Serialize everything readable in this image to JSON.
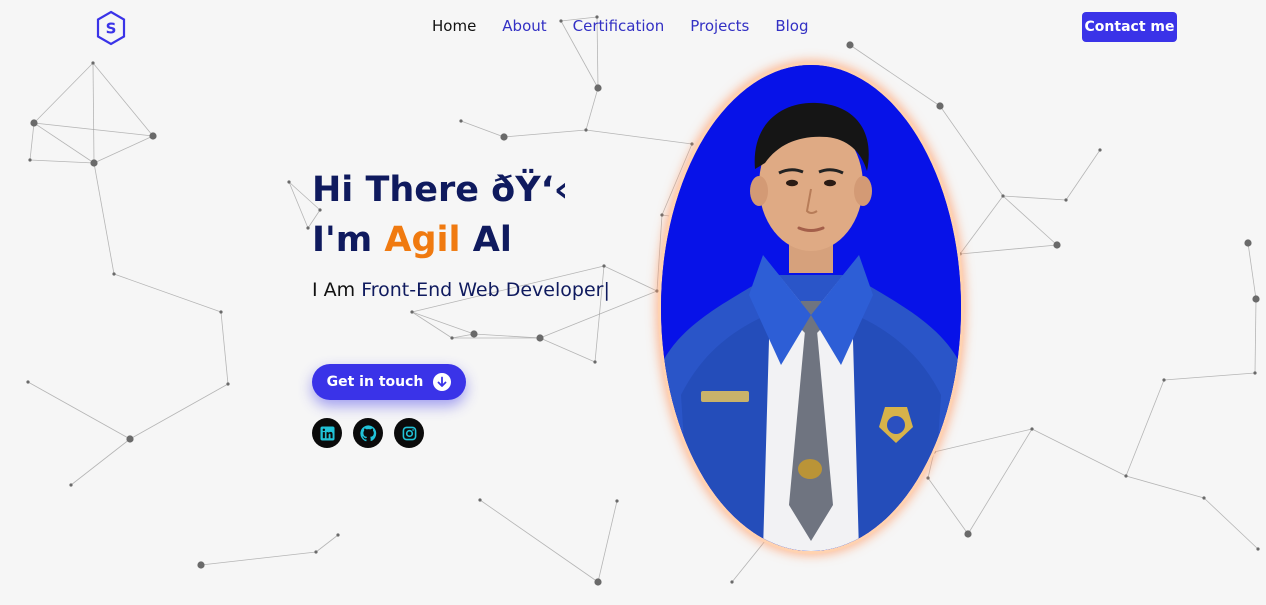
{
  "logo": {
    "letter": "S",
    "icon": "hexagon-logo-icon"
  },
  "nav": {
    "items": [
      {
        "label": "Home",
        "active": true
      },
      {
        "label": "About",
        "active": false
      },
      {
        "label": "Certification",
        "active": false
      },
      {
        "label": "Projects",
        "active": false
      },
      {
        "label": "Blog",
        "active": false
      }
    ],
    "contact_label": "Contact me"
  },
  "hero": {
    "greeting": "Hi There ðŸ‘‹",
    "name_prefix": "I'm ",
    "name_highlight": "Agil",
    "name_suffix": " Al",
    "subtitle_prefix": "I Am ",
    "subtitle_role": "Front-End Web Developer|",
    "cta_label": "Get in touch",
    "cta_icon": "arrow-down-circle-icon"
  },
  "socials": [
    {
      "icon": "linkedin-icon",
      "icon_color": "#21c3d8"
    },
    {
      "icon": "github-icon",
      "icon_color": "#21c3d8"
    },
    {
      "icon": "instagram-icon",
      "icon_color": "#21c3d8"
    }
  ],
  "portrait": {
    "label": "profile-photo",
    "background": "#0712e8"
  },
  "colors": {
    "accent": "#3a33e8",
    "highlight": "#f07a10",
    "heading": "#0f1a5e",
    "background": "#f6f6f6",
    "icon_teal": "#21c3d8"
  }
}
